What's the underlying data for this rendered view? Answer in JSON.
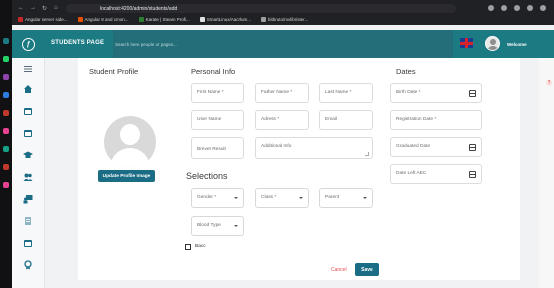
{
  "browser": {
    "url": "localhost:4200/admin/students/add",
    "bookmarks": [
      {
        "label": "Angular server side...",
        "color": "#c62828"
      },
      {
        "label": "Angular 8 and cmon...",
        "color": "#e65100"
      },
      {
        "label": "Karate | Steam Profi...",
        "color": "#2e7d32"
      },
      {
        "label": "SmartLinux/Aacrlum...",
        "color": "#e0e0e0"
      },
      {
        "label": "bitbruto/mvlibrister...",
        "color": "#9e9e9e"
      }
    ]
  },
  "header": {
    "page_title": "STUDENTS PAGE",
    "search_placeholder": "Search here people or pages...",
    "welcome": "Welcome"
  },
  "profile": {
    "title": "Student Profile",
    "update_button": "Update Profile Image"
  },
  "personal_info": {
    "title": "Personal Info",
    "first_name": "First Name *",
    "father_name": "Father Name *",
    "last_name": "Last Name *",
    "user_name": "User Name",
    "address": "Adress *",
    "email": "Email",
    "brevet_result": "Brevet Result",
    "additional_info": "Additional Info"
  },
  "selections": {
    "title": "Selections",
    "gender": "Gender *",
    "class": "Class *",
    "parent": "Parent",
    "blood_type": "Blood Type",
    "bacc": "Bacc"
  },
  "dates": {
    "title": "Dates",
    "birth_date": "Birth Date *",
    "registration_date": "Registration Date *",
    "graduated_date": "Graduated Date",
    "date_left": "Date Left AEC"
  },
  "actions": {
    "cancel": "Cancel",
    "save": "Save"
  },
  "help": "?",
  "colors": {
    "primary": "#1b7a82",
    "button": "#1b6d86",
    "cancel": "#e14b4b"
  }
}
